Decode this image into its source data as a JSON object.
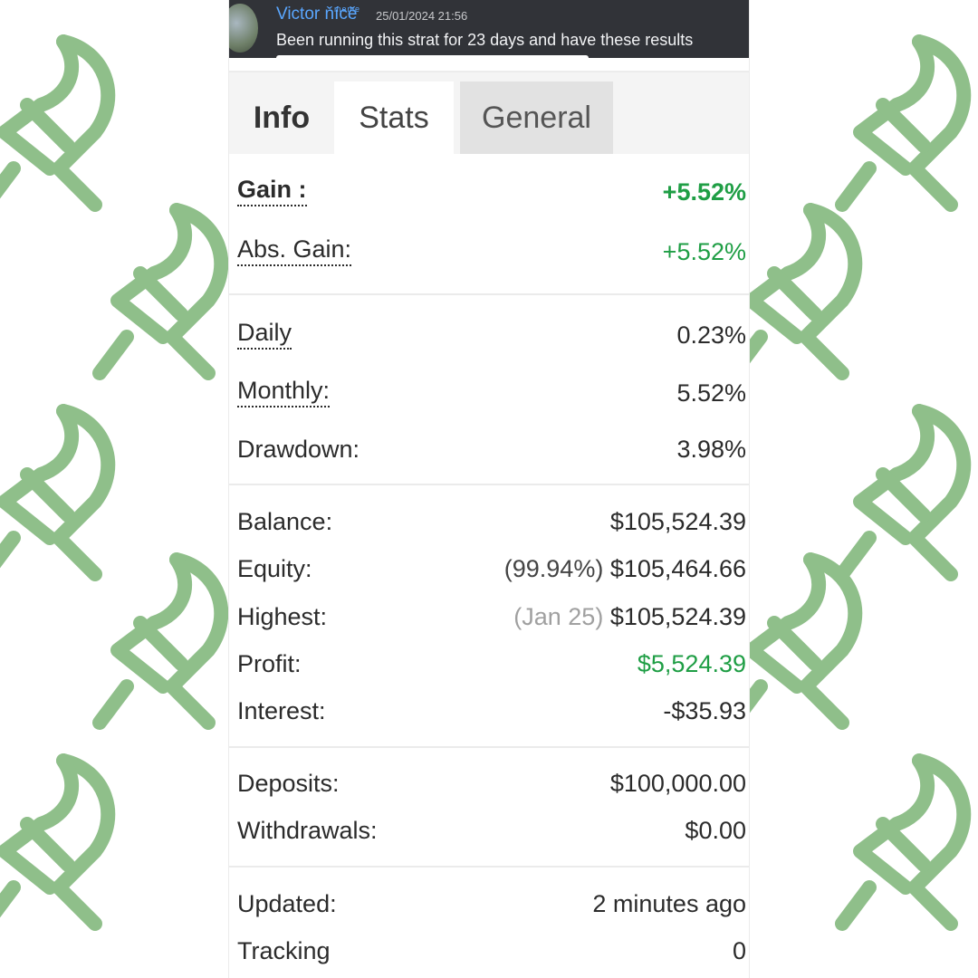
{
  "chat": {
    "username": "Victor ňícě",
    "badge": "meme",
    "timestamp": "25/01/2024 21:56",
    "message": "Been running this strat for 23 days and have these results"
  },
  "tabs": [
    {
      "label": "Info"
    },
    {
      "label": "Stats"
    },
    {
      "label": "General"
    }
  ],
  "gain": {
    "gain_label": "Gain :",
    "gain_value": "+5.52%",
    "abs_gain_label": "Abs. Gain:",
    "abs_gain_value": "+5.52%"
  },
  "rates": {
    "daily_label": "Daily",
    "daily_value": "0.23%",
    "monthly_label": "Monthly:",
    "monthly_value": "5.52%",
    "drawdown_label": "Drawdown:",
    "drawdown_value": "3.98%"
  },
  "account": {
    "balance_label": "Balance:",
    "balance_value": "$105,524.39",
    "equity_label": "Equity:",
    "equity_note": "(99.94%)",
    "equity_value": "$105,464.66",
    "highest_label": "Highest:",
    "highest_note": "(Jan 25)",
    "highest_value": "$105,524.39",
    "profit_label": "Profit:",
    "profit_value": "$5,524.39",
    "interest_label": "Interest:",
    "interest_value": "-$35.93"
  },
  "transfers": {
    "deposits_label": "Deposits:",
    "deposits_value": "$100,000.00",
    "withdrawals_label": "Withdrawals:",
    "withdrawals_value": "$0.00"
  },
  "meta": {
    "updated_label": "Updated:",
    "updated_value": "2 minutes ago",
    "tracking_label": "Tracking",
    "tracking_value": "0"
  },
  "colors": {
    "positive": "#1f9e45",
    "logo": "#8fbf8a",
    "chat_bg": "#313338"
  }
}
